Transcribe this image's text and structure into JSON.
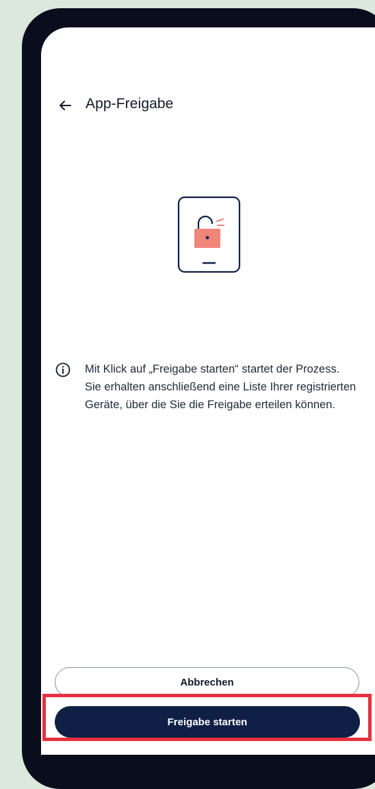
{
  "header": {
    "title": "App-Freigabe",
    "back_icon": "arrow-left-icon"
  },
  "illustration": {
    "icon": "phone-unlocked-padlock-icon",
    "accent_color": "#f0857a",
    "outline_color": "#0f1f45"
  },
  "info": {
    "icon": "info-circle-icon",
    "text": "Mit Klick auf „Freigabe starten“ startet der Prozess. Sie erhalten anschließend eine Liste Ihrer registrierten Geräte, über die Sie die Freigabe erteilen können."
  },
  "actions": {
    "cancel_label": "Abbrechen",
    "start_label": "Freigabe starten"
  },
  "colors": {
    "background": "#dbe8dc",
    "frame": "#0a0d1c",
    "primary": "#0f1f45",
    "highlight": "#e6313f"
  }
}
